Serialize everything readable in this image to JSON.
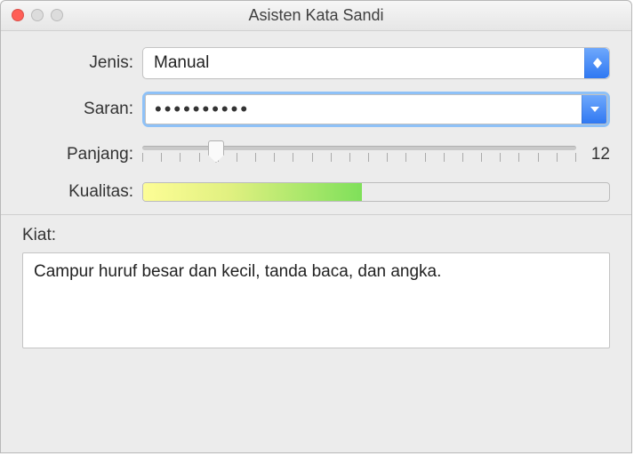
{
  "window": {
    "title": "Asisten Kata Sandi"
  },
  "labels": {
    "type": "Jenis:",
    "suggestion": "Saran:",
    "length": "Panjang:",
    "quality": "Kualitas:",
    "tips": "Kiat:"
  },
  "type": {
    "selected": "Manual"
  },
  "suggestion": {
    "masked": "••••••••••"
  },
  "length": {
    "value": "12",
    "min": 8,
    "max": 31,
    "percent": 17
  },
  "quality": {
    "percent": 47
  },
  "tips": {
    "text": "Campur huruf besar dan kecil, tanda baca, dan angka."
  }
}
